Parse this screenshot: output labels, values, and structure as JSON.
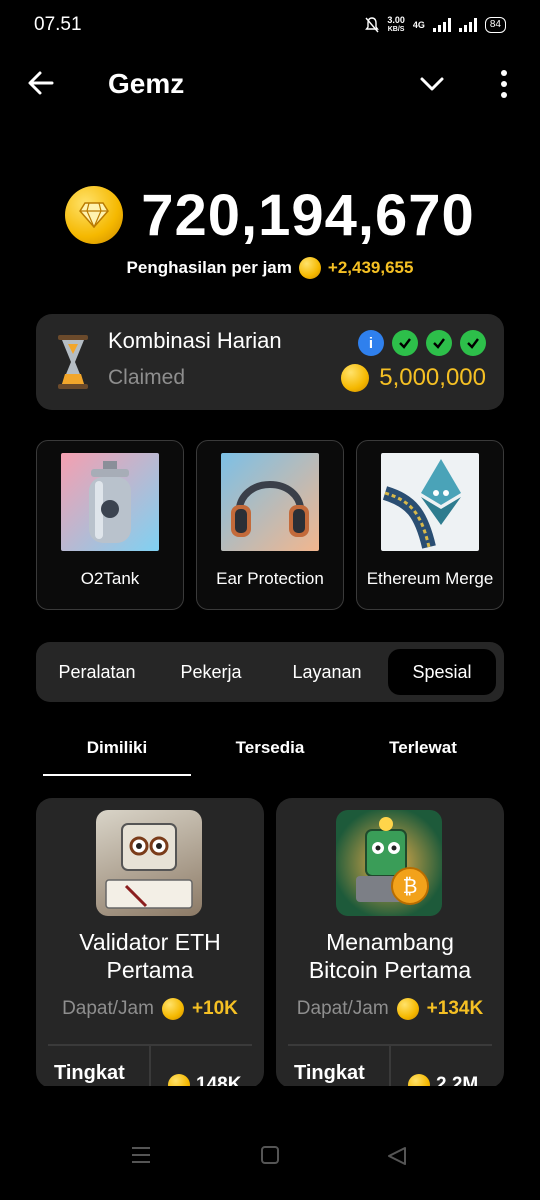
{
  "status": {
    "time": "07.51",
    "speed_top": "3.00",
    "speed_unit": "KB/S",
    "network": "4G",
    "battery": "84"
  },
  "header": {
    "title": "Gemz",
    "back_icon": "arrow-left-icon",
    "dropdown_icon": "chevron-down-icon",
    "menu_icon": "more-vertical-icon"
  },
  "balance": {
    "value": "720,194,670",
    "rate_label": "Penghasilan per jam",
    "rate_value": "+2,439,655"
  },
  "combo": {
    "title": "Kombinasi Harian",
    "status": "Claimed",
    "reward": "5,000,000",
    "info_label": "i",
    "checks": [
      "✓",
      "✓",
      "✓"
    ]
  },
  "daily_cards": [
    {
      "label": "O2Tank"
    },
    {
      "label": "Ear Protection"
    },
    {
      "label": "Ethereum Merge"
    }
  ],
  "category_tabs": [
    "Peralatan",
    "Pekerja",
    "Layanan",
    "Spesial"
  ],
  "active_category": "Spesial",
  "sub_tabs": [
    "Dimiliki",
    "Tersedia",
    "Terlewat"
  ],
  "active_sub_tab": "Dimiliki",
  "items": [
    {
      "name_line1": "Validator ETH",
      "name_line2": "Pertama",
      "earn_label": "Dapat/Jam",
      "earn_value": "+10K",
      "level_label": "Tingkat",
      "cost": "148K"
    },
    {
      "name_line1": "Menambang",
      "name_line2": "Bitcoin Pertama",
      "earn_label": "Dapat/Jam",
      "earn_value": "+134K",
      "level_label": "Tingkat",
      "cost": "2.2M"
    }
  ],
  "colors": {
    "background": "#000000",
    "card": "#262626",
    "gold": "#f5c024",
    "muted": "#8e8e8e",
    "check_green": "#2dbf4a",
    "info_blue": "#2f80ed"
  }
}
